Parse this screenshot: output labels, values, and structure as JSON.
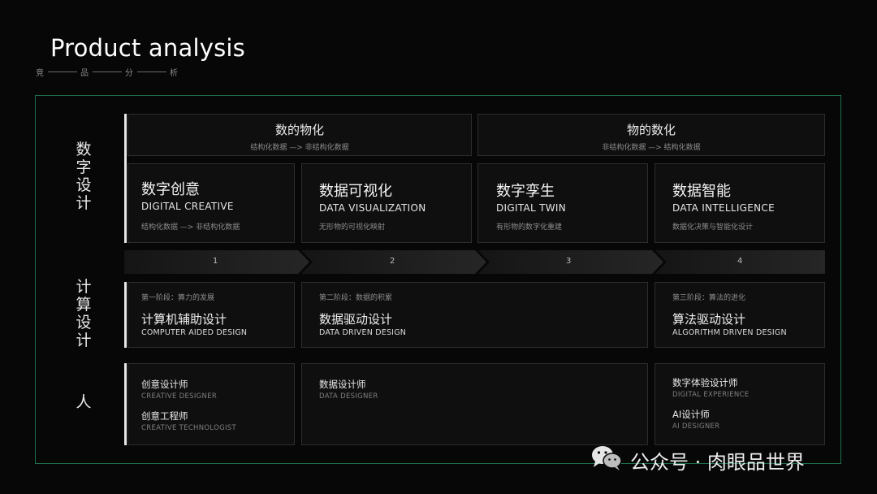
{
  "page": {
    "title": "Product analysis",
    "subtitle_chars": [
      "竞",
      "品",
      "分",
      "析"
    ]
  },
  "row_labels": {
    "digital_design": [
      "数",
      "字",
      "设",
      "计"
    ],
    "computational_design": [
      "计",
      "算",
      "设",
      "计"
    ],
    "people": [
      "人"
    ]
  },
  "headers": [
    {
      "title": "数的物化",
      "sub": "结构化数据 —> 非结构化数据"
    },
    {
      "title": "物的数化",
      "sub": "非结构化数据 —> 结构化数据"
    }
  ],
  "categories": [
    {
      "cn": "数字创意",
      "en": "DIGITAL CREATIVE",
      "desc": "结构化数据 —> 非结构化数据"
    },
    {
      "cn": "数据可视化",
      "en": "DATA VISUALIZATION",
      "desc": "无形物的可视化映射"
    },
    {
      "cn": "数字孪生",
      "en": "DIGITAL TWIN",
      "desc": "有形物的数字化重建"
    },
    {
      "cn": "数据智能",
      "en": "DATA INTELLIGENCE",
      "desc": "数据化决策与智能化设计"
    }
  ],
  "steps": [
    "1",
    "2",
    "3",
    "4"
  ],
  "phases": [
    {
      "phase": "第一阶段：算力的发展",
      "cn": "计算机辅助设计",
      "en": "COMPUTER AIDED DESIGN"
    },
    {
      "phase": "第二阶段：数据的积累",
      "cn": "数据驱动设计",
      "en": "DATA DRIVEN DESIGN"
    },
    {
      "phase": "第三阶段：算法的进化",
      "cn": "算法驱动设计",
      "en": "ALGORITHM DRIVEN DESIGN"
    }
  ],
  "roles": {
    "left": [
      {
        "cn": "创意设计师",
        "en": "CREATIVE DESIGNER"
      },
      {
        "cn": "创意工程师",
        "en": "CREATIVE TECHNOLOGIST"
      }
    ],
    "middle": [
      {
        "cn": "数据设计师",
        "en": "DATA DESIGNER"
      }
    ],
    "right": [
      {
        "cn": "数字体验设计师",
        "en": "DIGITAL EXPERIENCE"
      },
      {
        "cn": "AI设计师",
        "en": "AI DESIGNER"
      }
    ]
  },
  "watermark": {
    "icon": "wechat-icon",
    "text": "公众号 · 肉眼品世界"
  },
  "colors": {
    "background": "#070707",
    "frame_border": "#1f6f4d",
    "accent_bar": "#e8e8e8"
  }
}
